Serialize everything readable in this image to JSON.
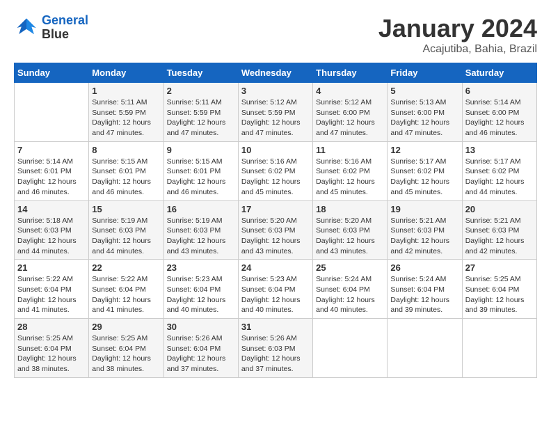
{
  "header": {
    "logo_line1": "General",
    "logo_line2": "Blue",
    "title": "January 2024",
    "subtitle": "Acajutiba, Bahia, Brazil"
  },
  "days_of_week": [
    "Sunday",
    "Monday",
    "Tuesday",
    "Wednesday",
    "Thursday",
    "Friday",
    "Saturday"
  ],
  "weeks": [
    [
      {
        "day": "",
        "info": ""
      },
      {
        "day": "1",
        "info": "Sunrise: 5:11 AM\nSunset: 5:59 PM\nDaylight: 12 hours\nand 47 minutes."
      },
      {
        "day": "2",
        "info": "Sunrise: 5:11 AM\nSunset: 5:59 PM\nDaylight: 12 hours\nand 47 minutes."
      },
      {
        "day": "3",
        "info": "Sunrise: 5:12 AM\nSunset: 5:59 PM\nDaylight: 12 hours\nand 47 minutes."
      },
      {
        "day": "4",
        "info": "Sunrise: 5:12 AM\nSunset: 6:00 PM\nDaylight: 12 hours\nand 47 minutes."
      },
      {
        "day": "5",
        "info": "Sunrise: 5:13 AM\nSunset: 6:00 PM\nDaylight: 12 hours\nand 47 minutes."
      },
      {
        "day": "6",
        "info": "Sunrise: 5:14 AM\nSunset: 6:00 PM\nDaylight: 12 hours\nand 46 minutes."
      }
    ],
    [
      {
        "day": "7",
        "info": "Sunrise: 5:14 AM\nSunset: 6:01 PM\nDaylight: 12 hours\nand 46 minutes."
      },
      {
        "day": "8",
        "info": "Sunrise: 5:15 AM\nSunset: 6:01 PM\nDaylight: 12 hours\nand 46 minutes."
      },
      {
        "day": "9",
        "info": "Sunrise: 5:15 AM\nSunset: 6:01 PM\nDaylight: 12 hours\nand 46 minutes."
      },
      {
        "day": "10",
        "info": "Sunrise: 5:16 AM\nSunset: 6:02 PM\nDaylight: 12 hours\nand 45 minutes."
      },
      {
        "day": "11",
        "info": "Sunrise: 5:16 AM\nSunset: 6:02 PM\nDaylight: 12 hours\nand 45 minutes."
      },
      {
        "day": "12",
        "info": "Sunrise: 5:17 AM\nSunset: 6:02 PM\nDaylight: 12 hours\nand 45 minutes."
      },
      {
        "day": "13",
        "info": "Sunrise: 5:17 AM\nSunset: 6:02 PM\nDaylight: 12 hours\nand 44 minutes."
      }
    ],
    [
      {
        "day": "14",
        "info": "Sunrise: 5:18 AM\nSunset: 6:03 PM\nDaylight: 12 hours\nand 44 minutes."
      },
      {
        "day": "15",
        "info": "Sunrise: 5:19 AM\nSunset: 6:03 PM\nDaylight: 12 hours\nand 44 minutes."
      },
      {
        "day": "16",
        "info": "Sunrise: 5:19 AM\nSunset: 6:03 PM\nDaylight: 12 hours\nand 43 minutes."
      },
      {
        "day": "17",
        "info": "Sunrise: 5:20 AM\nSunset: 6:03 PM\nDaylight: 12 hours\nand 43 minutes."
      },
      {
        "day": "18",
        "info": "Sunrise: 5:20 AM\nSunset: 6:03 PM\nDaylight: 12 hours\nand 43 minutes."
      },
      {
        "day": "19",
        "info": "Sunrise: 5:21 AM\nSunset: 6:03 PM\nDaylight: 12 hours\nand 42 minutes."
      },
      {
        "day": "20",
        "info": "Sunrise: 5:21 AM\nSunset: 6:03 PM\nDaylight: 12 hours\nand 42 minutes."
      }
    ],
    [
      {
        "day": "21",
        "info": "Sunrise: 5:22 AM\nSunset: 6:04 PM\nDaylight: 12 hours\nand 41 minutes."
      },
      {
        "day": "22",
        "info": "Sunrise: 5:22 AM\nSunset: 6:04 PM\nDaylight: 12 hours\nand 41 minutes."
      },
      {
        "day": "23",
        "info": "Sunrise: 5:23 AM\nSunset: 6:04 PM\nDaylight: 12 hours\nand 40 minutes."
      },
      {
        "day": "24",
        "info": "Sunrise: 5:23 AM\nSunset: 6:04 PM\nDaylight: 12 hours\nand 40 minutes."
      },
      {
        "day": "25",
        "info": "Sunrise: 5:24 AM\nSunset: 6:04 PM\nDaylight: 12 hours\nand 40 minutes."
      },
      {
        "day": "26",
        "info": "Sunrise: 5:24 AM\nSunset: 6:04 PM\nDaylight: 12 hours\nand 39 minutes."
      },
      {
        "day": "27",
        "info": "Sunrise: 5:25 AM\nSunset: 6:04 PM\nDaylight: 12 hours\nand 39 minutes."
      }
    ],
    [
      {
        "day": "28",
        "info": "Sunrise: 5:25 AM\nSunset: 6:04 PM\nDaylight: 12 hours\nand 38 minutes."
      },
      {
        "day": "29",
        "info": "Sunrise: 5:25 AM\nSunset: 6:04 PM\nDaylight: 12 hours\nand 38 minutes."
      },
      {
        "day": "30",
        "info": "Sunrise: 5:26 AM\nSunset: 6:04 PM\nDaylight: 12 hours\nand 37 minutes."
      },
      {
        "day": "31",
        "info": "Sunrise: 5:26 AM\nSunset: 6:03 PM\nDaylight: 12 hours\nand 37 minutes."
      },
      {
        "day": "",
        "info": ""
      },
      {
        "day": "",
        "info": ""
      },
      {
        "day": "",
        "info": ""
      }
    ]
  ]
}
